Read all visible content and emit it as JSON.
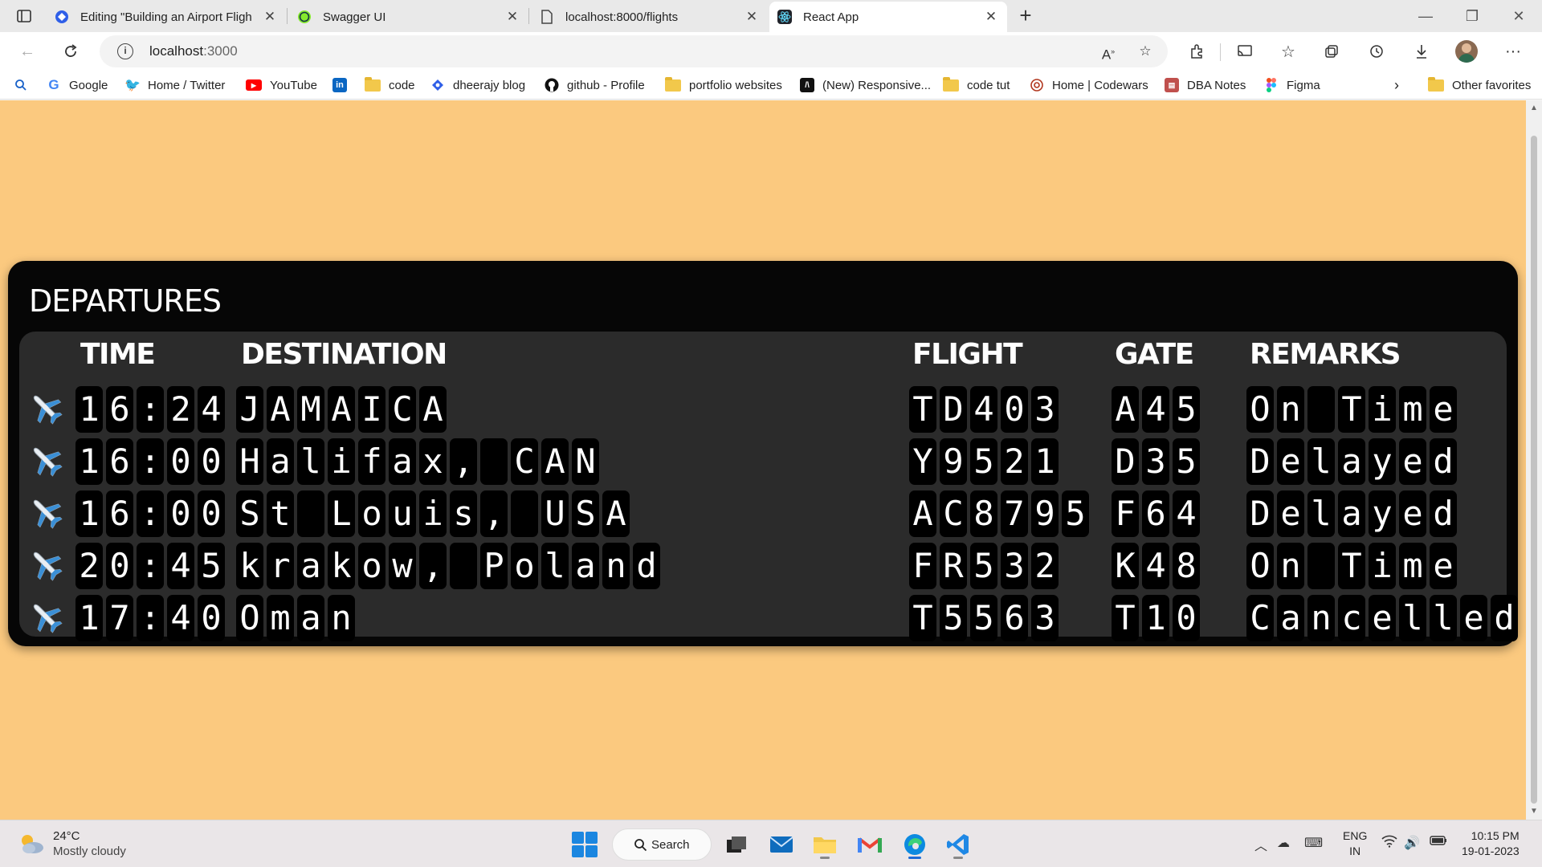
{
  "browser": {
    "tabs": [
      {
        "title": "Editing \"Building an Airport Fligh",
        "icon": "wordpress-icon"
      },
      {
        "title": "Swagger UI",
        "icon": "swagger-icon"
      },
      {
        "title": "localhost:8000/flights",
        "icon": "page-icon"
      },
      {
        "title": "React App",
        "icon": "react-icon"
      }
    ],
    "url_host": "localhost",
    "url_path": ":3000",
    "favorites": [
      {
        "label": "Google"
      },
      {
        "label": "Home / Twitter"
      },
      {
        "label": "YouTube"
      },
      {
        "label": "code"
      },
      {
        "label": "dheerajy blog"
      },
      {
        "label": "github - Profile"
      },
      {
        "label": "portfolio websites"
      },
      {
        "label": "(New) Responsive..."
      },
      {
        "label": "code tut"
      },
      {
        "label": "Home | Codewars"
      },
      {
        "label": "DBA Notes"
      },
      {
        "label": "Figma"
      }
    ],
    "other_favorites": "Other favorites"
  },
  "board": {
    "title": "DEPARTURES",
    "headers": {
      "time": "TIME",
      "destination": "DESTINATION",
      "flight": "FLIGHT",
      "gate": "GATE",
      "remarks": "REMARKS"
    },
    "flights": [
      {
        "time": "16:24",
        "destination": "JAMAICA",
        "flight": "TD403",
        "gate": "A45",
        "remarks": "On Time"
      },
      {
        "time": "16:00",
        "destination": "Halifax, CAN",
        "flight": "Y9521",
        "gate": "D35",
        "remarks": "Delayed"
      },
      {
        "time": "16:00",
        "destination": "St Louis, USA",
        "flight": "AC8795",
        "gate": "F64",
        "remarks": "Delayed"
      },
      {
        "time": "20:45",
        "destination": "krakow, Poland",
        "flight": "FR532",
        "gate": "K48",
        "remarks": "On Time"
      },
      {
        "time": "17:40",
        "destination": "Oman",
        "flight": "T5563",
        "gate": "T10",
        "remarks": "Cancelled"
      }
    ]
  },
  "taskbar": {
    "weather_temp": "24°C",
    "weather_cond": "Mostly cloudy",
    "search_label": "Search",
    "lang_line1": "ENG",
    "lang_line2": "IN",
    "time": "10:15 PM",
    "date": "19-01-2023"
  },
  "colors": {
    "page_bg": "#fbc97f",
    "board_bg": "#060606",
    "board_inner_bg": "#2b2b2b",
    "cell_bg": "#000000",
    "text": "#ffffff"
  }
}
